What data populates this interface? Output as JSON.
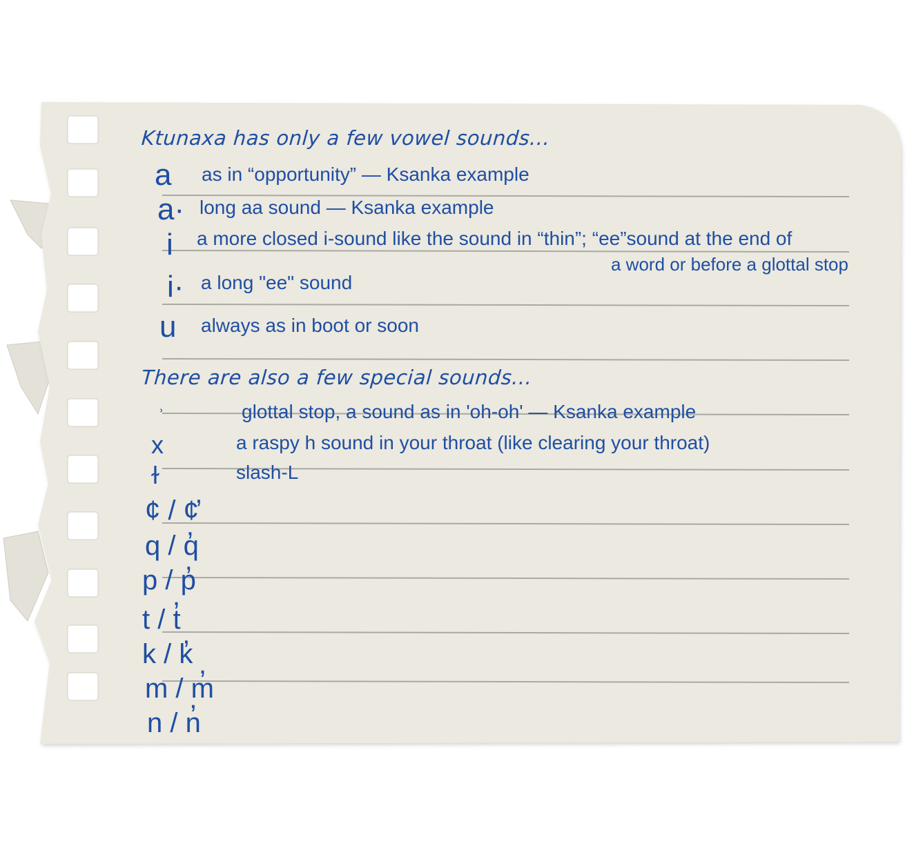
{
  "vowels": {
    "heading": "Ktunaxa has only a few vowel sounds...",
    "items": [
      {
        "glyph": "a",
        "text": "as in “opportunity” — Ksanka example"
      },
      {
        "glyph": "a·",
        "text": "long aa sound — Ksanka example"
      },
      {
        "glyph": "i",
        "text": "a more closed i-sound like the sound in “thin”; “ee”sound at the end of",
        "text2": "a word or before a glottal stop"
      },
      {
        "glyph": "i·",
        "text": "a long \"ee\" sound"
      },
      {
        "glyph": "u",
        "text": "always as in boot or soon"
      }
    ]
  },
  "special": {
    "heading": "There are also a few special sounds...",
    "items": [
      {
        "glyph": "ʾ",
        "text": "glottal stop, a sound as in 'oh-oh' — Ksanka example"
      },
      {
        "glyph": "x",
        "text": "a raspy h sound in your throat (like clearing your throat)"
      },
      {
        "glyph": "ɫ",
        "text": "slash-L"
      }
    ],
    "pairs": [
      "¢ / ¢̓",
      "q / q̓",
      "p / p̓",
      "t / t̓",
      "k / k̓",
      "m / m̓",
      "n / n̓"
    ]
  },
  "colors": {
    "ink": "#1f4ea3",
    "paper": "#ebe9e0",
    "rule": "#a9a9a4"
  }
}
